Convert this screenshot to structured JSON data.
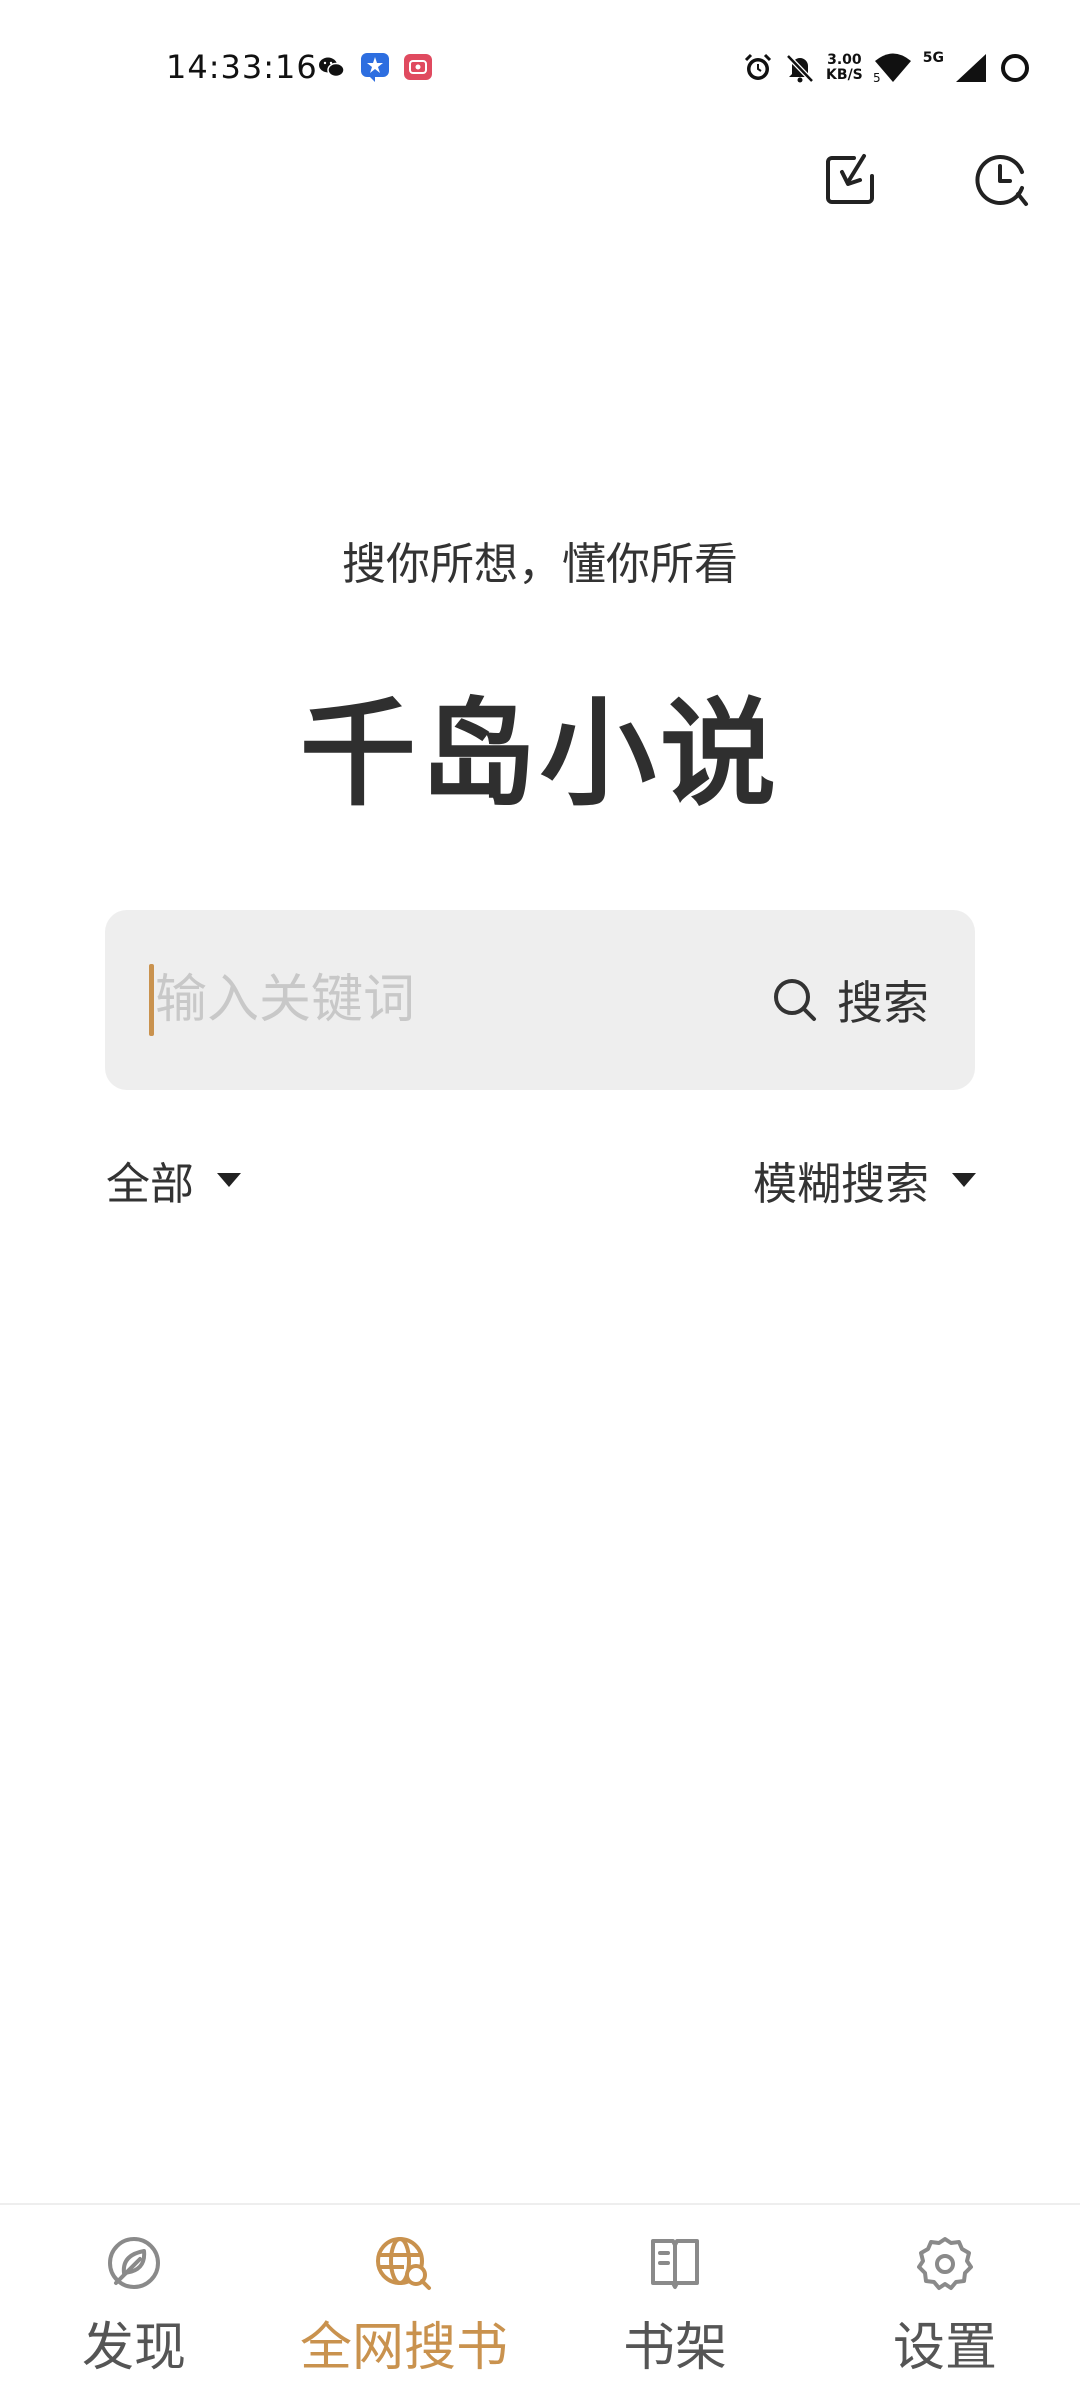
{
  "status_bar": {
    "time": "14:33:16",
    "net_speed_value": "3.00",
    "net_speed_unit": "KB/S",
    "network_type": "5G",
    "sim_slot": "5",
    "app_icons": [
      "wechat-icon",
      "blue-star-app-icon",
      "red-video-app-icon"
    ],
    "right_icons": [
      "alarm-icon",
      "silent-bell-icon",
      "wifi-icon",
      "signal-icon",
      "battery-ring-icon"
    ]
  },
  "top_actions": {
    "download_icon": "download-box-icon",
    "history_icon": "clock-icon"
  },
  "hero": {
    "slogan": "搜你所想，懂你所看",
    "app_title": "千岛小说"
  },
  "search": {
    "placeholder": "输入关键词",
    "value": "",
    "button_label": "搜索"
  },
  "filters": {
    "category_selected": "全部",
    "mode_selected": "模糊搜索"
  },
  "bottom_nav": {
    "items": [
      {
        "label": "发现",
        "icon": "compass-leaf-icon",
        "active": false
      },
      {
        "label": "全网搜书",
        "icon": "globe-search-icon",
        "active": true
      },
      {
        "label": "书架",
        "icon": "open-book-icon",
        "active": false
      },
      {
        "label": "设置",
        "icon": "gear-icon",
        "active": false
      }
    ]
  },
  "colors": {
    "accent": "#c9924e",
    "text": "#333333",
    "search_bg": "#eeeeee",
    "inactive_icon": "#8a8a8a"
  }
}
